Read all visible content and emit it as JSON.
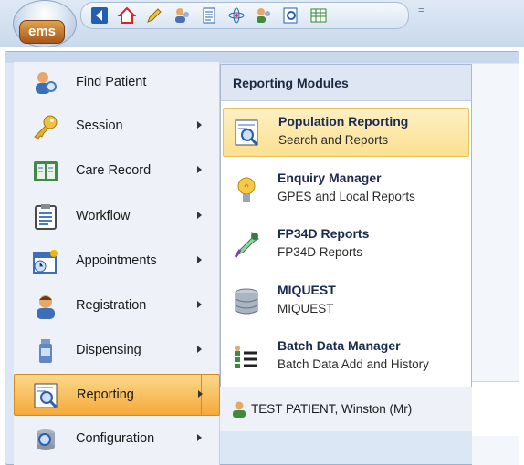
{
  "app": {
    "logo_text": "ems"
  },
  "quick_access": {
    "icons": [
      "back-icon",
      "home-icon",
      "pencil-icon",
      "users-icon",
      "document-icon",
      "atom-icon",
      "person-group-icon",
      "search-document-icon",
      "table-icon"
    ],
    "dropdown_glyph": "="
  },
  "left_menu": {
    "items": [
      {
        "label": "Find Patient",
        "icon": "find-patient-icon",
        "has_submenu": false
      },
      {
        "label": "Session",
        "icon": "key-icon",
        "has_submenu": true
      },
      {
        "label": "Care Record",
        "icon": "care-record-icon",
        "has_submenu": true
      },
      {
        "label": "Workflow",
        "icon": "clipboard-icon",
        "has_submenu": true
      },
      {
        "label": "Appointments",
        "icon": "calendar-clock-icon",
        "has_submenu": true
      },
      {
        "label": "Registration",
        "icon": "person-icon",
        "has_submenu": true
      },
      {
        "label": "Dispensing",
        "icon": "medicine-bottle-icon",
        "has_submenu": true
      },
      {
        "label": "Reporting",
        "icon": "reporting-icon",
        "has_submenu": true,
        "active": true
      },
      {
        "label": "Configuration",
        "icon": "configuration-icon",
        "has_submenu": true
      }
    ]
  },
  "submenu": {
    "header": "Reporting Modules",
    "items": [
      {
        "title": "Population Reporting",
        "description": "Search and Reports",
        "icon": "population-reporting-icon"
      },
      {
        "title": "Enquiry Manager",
        "description": "GPES and Local Reports",
        "icon": "lightbulb-icon"
      },
      {
        "title": "FP34D Reports",
        "description": "FP34D Reports",
        "icon": "dropper-icon"
      },
      {
        "title": "MIQUEST",
        "description": "MIQUEST",
        "icon": "database-icon"
      },
      {
        "title": "Batch Data Manager",
        "description": "Batch Data Add and History",
        "icon": "batch-list-icon"
      }
    ]
  },
  "patient": {
    "name": "TEST PATIENT, Winston (Mr)"
  },
  "colors": {
    "active_item_top": "#fbd88b",
    "active_item_bottom": "#f6a93a",
    "hover_item": "#fbe08f",
    "menu_bg": "#eef2f8"
  }
}
